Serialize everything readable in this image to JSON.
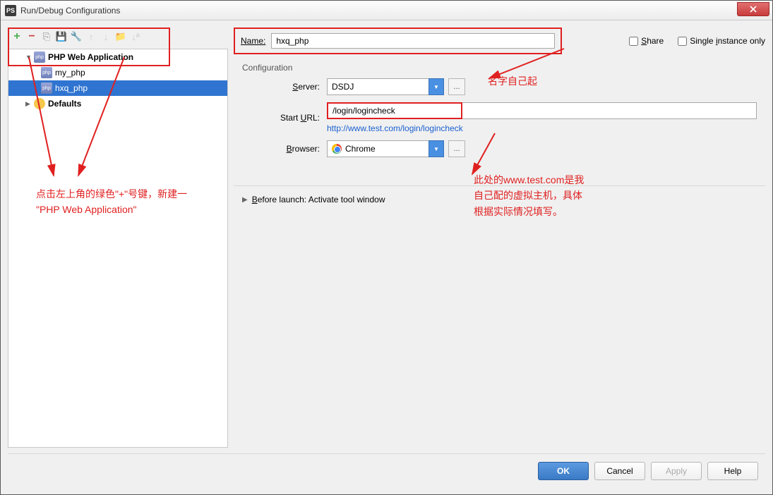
{
  "window": {
    "title": "Run/Debug Configurations",
    "app_icon": "PS"
  },
  "toolbar_icons": {
    "add": "+",
    "remove": "−",
    "copy": "⎘",
    "save": "💾",
    "wrench": "🔧",
    "up": "↑",
    "down": "↓",
    "folder": "📁",
    "sort": "↓ª"
  },
  "tree": {
    "root": "PHP Web Application",
    "items": [
      "my_php",
      "hxq_php"
    ],
    "defaults": "Defaults"
  },
  "form": {
    "name_label": "Name:",
    "name_value": "hxq_php",
    "share_label": "Share",
    "single_label": "Single instance only",
    "config_legend": "Configuration",
    "server_label": "Server:",
    "server_value": "DSDJ",
    "starturl_label": "Start URL:",
    "starturl_value": "/login/logincheck",
    "fullurl": "http://www.test.com/login/logincheck",
    "browser_label": "Browser:",
    "browser_value": "Chrome",
    "before_launch": "Before launch: Activate tool window",
    "dots": "..."
  },
  "annotations": {
    "a1": "名字自己起",
    "a2_l1": "点击左上角的绿色\"+\"号键，新建一",
    "a2_l2": "\"PHP Web Application\"",
    "a3_l1": "此处的www.test.com是我",
    "a3_l2": "自己配的虚拟主机，具体",
    "a3_l3": "根据实际情况填写。"
  },
  "buttons": {
    "ok": "OK",
    "cancel": "Cancel",
    "apply": "Apply",
    "help": "Help"
  }
}
